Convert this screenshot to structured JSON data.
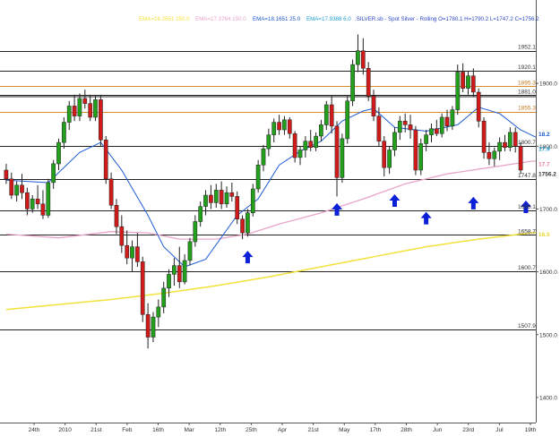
{
  "header": {
    "ema1": "EMA=16.2651 250.0",
    "ema2": "EMA=17.3764 150.0",
    "ema3": "EMA=18.1651 25.0",
    "ema4": "EMA=17.9388 6.0",
    "instrument": ".SILVER.sb - Spot Silver - Rolling O=1780.1 H=1790.2 L=1747.2 C=1756.2",
    "colors": {
      "ema1": "#f2e23a",
      "ema2": "#e9a5c8",
      "ema3": "#1e5bd6",
      "ema4": "#1e9bd6",
      "instrument": "#2d49c9"
    }
  },
  "chart_data": {
    "type": "candlestick",
    "ylim": [
      1360,
      1990
    ],
    "y_ticks": [
      1400.0,
      1500.0,
      1600.0,
      1700.0,
      1800.0,
      1900.0
    ],
    "x_ticks": [
      "24th",
      "2010",
      "21st",
      "Feb",
      "16th",
      "Mar",
      "12th",
      "25th",
      "Apr",
      "21st",
      "May",
      "17th",
      "28th",
      "Jun",
      "23rd",
      "Jul",
      "19th"
    ],
    "hlines": [
      {
        "value": 1952.1,
        "label": "1952.1",
        "color": "#222222"
      },
      {
        "value": 1920.1,
        "label": "1920.1",
        "color": "#222222"
      },
      {
        "value": 1895.3,
        "label": "1895.3",
        "color": "#d98c2b"
      },
      {
        "value": 1881.0,
        "label": "1881.0",
        "color": "#222222"
      },
      {
        "value": 1855.3,
        "label": "1855.3",
        "color": "#d98c2b"
      },
      {
        "value": 1800.7,
        "label": "1800.7",
        "color": "#222222"
      },
      {
        "value": 1747.8,
        "label": "1747.8",
        "color": "#222222"
      },
      {
        "value": 1698.1,
        "label": "1698.1",
        "color": "#222222"
      },
      {
        "value": 1658.7,
        "label": "1658.7",
        "color": "#222222"
      },
      {
        "value": 1600.7,
        "label": "1600.7",
        "color": "#222222"
      },
      {
        "value": 1507.9,
        "label": "1507.9",
        "color": "#222222"
      }
    ],
    "right_labels": [
      {
        "value": 1820.0,
        "label": "18.2",
        "color": "#1e5bd6"
      },
      {
        "value": 1796.0,
        "label": "17.9",
        "color": "#1e9bd6"
      },
      {
        "value": 1772.0,
        "label": "17.7",
        "color": "#e87aa8"
      },
      {
        "value": 1660.0,
        "label": "16.5",
        "color": "#e6d72e"
      },
      {
        "value": 1756.2,
        "label": "1756.2",
        "color": "#333333"
      }
    ],
    "candles": [
      {
        "o": 1762,
        "h": 1772,
        "l": 1740,
        "c": 1748
      },
      {
        "o": 1748,
        "h": 1758,
        "l": 1716,
        "c": 1722
      },
      {
        "o": 1722,
        "h": 1744,
        "l": 1712,
        "c": 1738
      },
      {
        "o": 1738,
        "h": 1756,
        "l": 1716,
        "c": 1726
      },
      {
        "o": 1726,
        "h": 1734,
        "l": 1690,
        "c": 1700
      },
      {
        "o": 1700,
        "h": 1722,
        "l": 1694,
        "c": 1716
      },
      {
        "o": 1716,
        "h": 1738,
        "l": 1700,
        "c": 1708
      },
      {
        "o": 1708,
        "h": 1730,
        "l": 1684,
        "c": 1690
      },
      {
        "o": 1690,
        "h": 1748,
        "l": 1686,
        "c": 1742
      },
      {
        "o": 1742,
        "h": 1778,
        "l": 1732,
        "c": 1772
      },
      {
        "o": 1772,
        "h": 1812,
        "l": 1762,
        "c": 1806
      },
      {
        "o": 1806,
        "h": 1846,
        "l": 1796,
        "c": 1838
      },
      {
        "o": 1838,
        "h": 1872,
        "l": 1826,
        "c": 1864
      },
      {
        "o": 1864,
        "h": 1882,
        "l": 1840,
        "c": 1848
      },
      {
        "o": 1848,
        "h": 1884,
        "l": 1840,
        "c": 1876
      },
      {
        "o": 1876,
        "h": 1890,
        "l": 1860,
        "c": 1868
      },
      {
        "o": 1868,
        "h": 1882,
        "l": 1840,
        "c": 1846
      },
      {
        "o": 1846,
        "h": 1880,
        "l": 1840,
        "c": 1874
      },
      {
        "o": 1874,
        "h": 1882,
        "l": 1800,
        "c": 1810
      },
      {
        "o": 1810,
        "h": 1816,
        "l": 1740,
        "c": 1748
      },
      {
        "o": 1748,
        "h": 1758,
        "l": 1700,
        "c": 1706
      },
      {
        "o": 1706,
        "h": 1716,
        "l": 1660,
        "c": 1672
      },
      {
        "o": 1672,
        "h": 1690,
        "l": 1630,
        "c": 1642
      },
      {
        "o": 1642,
        "h": 1666,
        "l": 1612,
        "c": 1622
      },
      {
        "o": 1622,
        "h": 1650,
        "l": 1600,
        "c": 1640
      },
      {
        "o": 1640,
        "h": 1662,
        "l": 1608,
        "c": 1616
      },
      {
        "o": 1616,
        "h": 1624,
        "l": 1520,
        "c": 1532
      },
      {
        "o": 1532,
        "h": 1550,
        "l": 1478,
        "c": 1496
      },
      {
        "o": 1496,
        "h": 1536,
        "l": 1488,
        "c": 1528
      },
      {
        "o": 1528,
        "h": 1556,
        "l": 1512,
        "c": 1544
      },
      {
        "o": 1544,
        "h": 1584,
        "l": 1534,
        "c": 1574
      },
      {
        "o": 1574,
        "h": 1604,
        "l": 1560,
        "c": 1596
      },
      {
        "o": 1596,
        "h": 1622,
        "l": 1578,
        "c": 1610
      },
      {
        "o": 1610,
        "h": 1640,
        "l": 1574,
        "c": 1584
      },
      {
        "o": 1584,
        "h": 1628,
        "l": 1580,
        "c": 1618
      },
      {
        "o": 1618,
        "h": 1654,
        "l": 1610,
        "c": 1648
      },
      {
        "o": 1648,
        "h": 1690,
        "l": 1640,
        "c": 1680
      },
      {
        "o": 1680,
        "h": 1712,
        "l": 1672,
        "c": 1704
      },
      {
        "o": 1704,
        "h": 1730,
        "l": 1690,
        "c": 1722
      },
      {
        "o": 1722,
        "h": 1738,
        "l": 1700,
        "c": 1710
      },
      {
        "o": 1710,
        "h": 1740,
        "l": 1702,
        "c": 1730
      },
      {
        "o": 1730,
        "h": 1744,
        "l": 1700,
        "c": 1708
      },
      {
        "o": 1708,
        "h": 1736,
        "l": 1702,
        "c": 1726
      },
      {
        "o": 1726,
        "h": 1742,
        "l": 1712,
        "c": 1720
      },
      {
        "o": 1720,
        "h": 1728,
        "l": 1676,
        "c": 1684
      },
      {
        "o": 1684,
        "h": 1690,
        "l": 1652,
        "c": 1662
      },
      {
        "o": 1662,
        "h": 1700,
        "l": 1656,
        "c": 1694
      },
      {
        "o": 1694,
        "h": 1740,
        "l": 1688,
        "c": 1732
      },
      {
        "o": 1732,
        "h": 1778,
        "l": 1726,
        "c": 1770
      },
      {
        "o": 1770,
        "h": 1802,
        "l": 1760,
        "c": 1796
      },
      {
        "o": 1796,
        "h": 1828,
        "l": 1784,
        "c": 1818
      },
      {
        "o": 1818,
        "h": 1844,
        "l": 1806,
        "c": 1838
      },
      {
        "o": 1838,
        "h": 1850,
        "l": 1818,
        "c": 1826
      },
      {
        "o": 1826,
        "h": 1848,
        "l": 1818,
        "c": 1842
      },
      {
        "o": 1842,
        "h": 1846,
        "l": 1812,
        "c": 1820
      },
      {
        "o": 1820,
        "h": 1824,
        "l": 1774,
        "c": 1782
      },
      {
        "o": 1782,
        "h": 1800,
        "l": 1770,
        "c": 1794
      },
      {
        "o": 1794,
        "h": 1816,
        "l": 1782,
        "c": 1808
      },
      {
        "o": 1808,
        "h": 1826,
        "l": 1792,
        "c": 1798
      },
      {
        "o": 1798,
        "h": 1822,
        "l": 1792,
        "c": 1816
      },
      {
        "o": 1816,
        "h": 1842,
        "l": 1808,
        "c": 1834
      },
      {
        "o": 1834,
        "h": 1872,
        "l": 1826,
        "c": 1866
      },
      {
        "o": 1866,
        "h": 1880,
        "l": 1820,
        "c": 1832
      },
      {
        "o": 1832,
        "h": 1840,
        "l": 1720,
        "c": 1750
      },
      {
        "o": 1750,
        "h": 1820,
        "l": 1742,
        "c": 1812
      },
      {
        "o": 1812,
        "h": 1880,
        "l": 1804,
        "c": 1872
      },
      {
        "o": 1872,
        "h": 1938,
        "l": 1864,
        "c": 1930
      },
      {
        "o": 1930,
        "h": 1978,
        "l": 1918,
        "c": 1952
      },
      {
        "o": 1952,
        "h": 1972,
        "l": 1914,
        "c": 1924
      },
      {
        "o": 1924,
        "h": 1934,
        "l": 1872,
        "c": 1880
      },
      {
        "o": 1880,
        "h": 1890,
        "l": 1840,
        "c": 1848
      },
      {
        "o": 1848,
        "h": 1862,
        "l": 1800,
        "c": 1808
      },
      {
        "o": 1808,
        "h": 1816,
        "l": 1752,
        "c": 1766
      },
      {
        "o": 1766,
        "h": 1800,
        "l": 1756,
        "c": 1794
      },
      {
        "o": 1794,
        "h": 1830,
        "l": 1784,
        "c": 1822
      },
      {
        "o": 1822,
        "h": 1848,
        "l": 1810,
        "c": 1840
      },
      {
        "o": 1840,
        "h": 1852,
        "l": 1822,
        "c": 1834
      },
      {
        "o": 1834,
        "h": 1850,
        "l": 1812,
        "c": 1826
      },
      {
        "o": 1826,
        "h": 1832,
        "l": 1754,
        "c": 1762
      },
      {
        "o": 1762,
        "h": 1812,
        "l": 1754,
        "c": 1804
      },
      {
        "o": 1804,
        "h": 1826,
        "l": 1792,
        "c": 1818
      },
      {
        "o": 1818,
        "h": 1836,
        "l": 1806,
        "c": 1828
      },
      {
        "o": 1828,
        "h": 1842,
        "l": 1816,
        "c": 1820
      },
      {
        "o": 1820,
        "h": 1852,
        "l": 1814,
        "c": 1846
      },
      {
        "o": 1846,
        "h": 1858,
        "l": 1824,
        "c": 1832
      },
      {
        "o": 1832,
        "h": 1864,
        "l": 1826,
        "c": 1858
      },
      {
        "o": 1858,
        "h": 1930,
        "l": 1850,
        "c": 1918
      },
      {
        "o": 1918,
        "h": 1932,
        "l": 1886,
        "c": 1892
      },
      {
        "o": 1892,
        "h": 1920,
        "l": 1882,
        "c": 1912
      },
      {
        "o": 1912,
        "h": 1924,
        "l": 1878,
        "c": 1886
      },
      {
        "o": 1886,
        "h": 1892,
        "l": 1830,
        "c": 1840
      },
      {
        "o": 1840,
        "h": 1846,
        "l": 1780,
        "c": 1790
      },
      {
        "o": 1790,
        "h": 1806,
        "l": 1770,
        "c": 1780
      },
      {
        "o": 1780,
        "h": 1798,
        "l": 1768,
        "c": 1792
      },
      {
        "o": 1792,
        "h": 1814,
        "l": 1778,
        "c": 1806
      },
      {
        "o": 1806,
        "h": 1818,
        "l": 1792,
        "c": 1798
      },
      {
        "o": 1798,
        "h": 1830,
        "l": 1792,
        "c": 1822
      },
      {
        "o": 1822,
        "h": 1830,
        "l": 1790,
        "c": 1800
      },
      {
        "o": 1800,
        "h": 1806,
        "l": 1756,
        "c": 1762
      }
    ],
    "ema_150": [
      [
        0,
        1660
      ],
      [
        10,
        1654
      ],
      [
        20,
        1664
      ],
      [
        27,
        1662
      ],
      [
        33,
        1652
      ],
      [
        40,
        1652
      ],
      [
        46,
        1660
      ],
      [
        52,
        1676
      ],
      [
        60,
        1694
      ],
      [
        68,
        1716
      ],
      [
        76,
        1740
      ],
      [
        84,
        1756
      ],
      [
        92,
        1766
      ],
      [
        100,
        1776
      ],
      [
        104,
        1778
      ]
    ],
    "ema_25": [
      [
        0,
        1746
      ],
      [
        8,
        1742
      ],
      [
        14,
        1790
      ],
      [
        18,
        1806
      ],
      [
        22,
        1762
      ],
      [
        27,
        1690
      ],
      [
        30,
        1640
      ],
      [
        34,
        1608
      ],
      [
        38,
        1620
      ],
      [
        44,
        1690
      ],
      [
        48,
        1716
      ],
      [
        52,
        1770
      ],
      [
        56,
        1792
      ],
      [
        60,
        1808
      ],
      [
        64,
        1840
      ],
      [
        68,
        1856
      ],
      [
        70,
        1860
      ],
      [
        74,
        1830
      ],
      [
        80,
        1824
      ],
      [
        86,
        1834
      ],
      [
        90,
        1862
      ],
      [
        94,
        1852
      ],
      [
        98,
        1826
      ],
      [
        102,
        1810
      ],
      [
        104,
        1806
      ]
    ],
    "ema_250": [
      [
        0,
        1540
      ],
      [
        10,
        1548
      ],
      [
        20,
        1556
      ],
      [
        30,
        1566
      ],
      [
        40,
        1578
      ],
      [
        50,
        1592
      ],
      [
        60,
        1608
      ],
      [
        70,
        1624
      ],
      [
        80,
        1640
      ],
      [
        90,
        1652
      ],
      [
        100,
        1662
      ],
      [
        104,
        1664
      ]
    ],
    "arrows": [
      {
        "index": 46,
        "price": 1642
      },
      {
        "index": 63,
        "price": 1718
      },
      {
        "index": 74,
        "price": 1732
      },
      {
        "index": 80,
        "price": 1704
      },
      {
        "index": 89,
        "price": 1728
      },
      {
        "index": 99,
        "price": 1722
      }
    ]
  }
}
